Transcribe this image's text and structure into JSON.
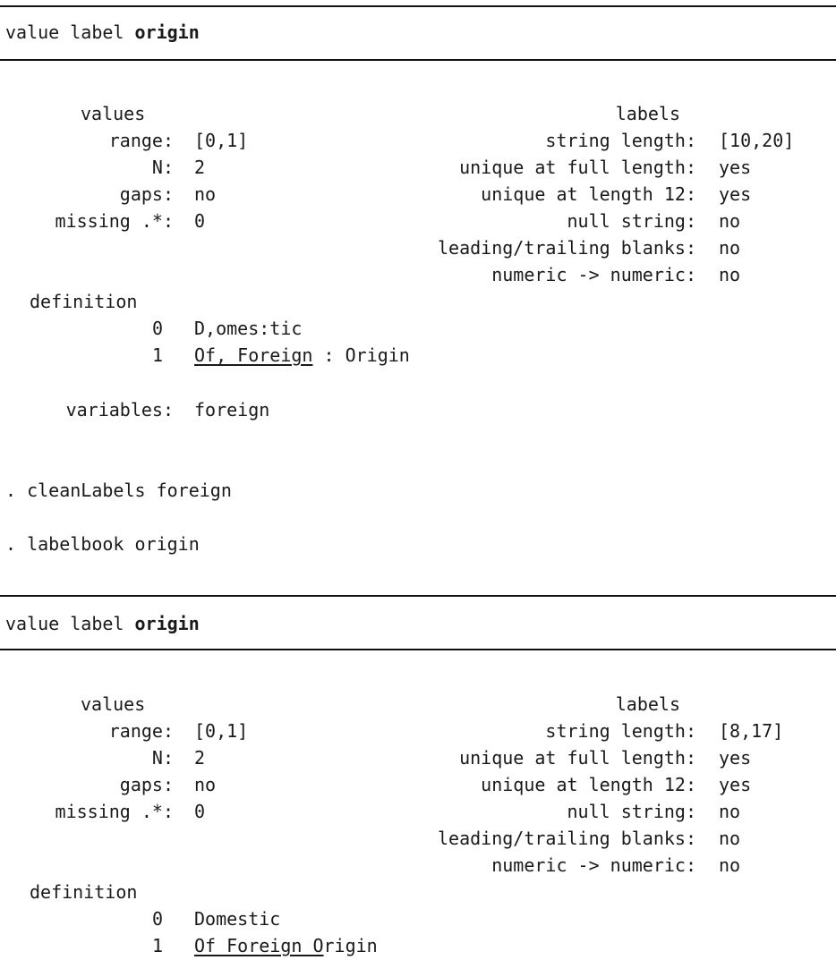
{
  "value_label_prefix": "value label",
  "label_name": "origin",
  "section_labels": {
    "values": "values",
    "labels": "labels",
    "range": "range:",
    "n": "N:",
    "gaps": "gaps:",
    "missing": "missing .*:",
    "string_length": "string length:",
    "unique_full": "unique at full length:",
    "unique_12": "unique at length 12:",
    "null_string": "null string:",
    "leading_trailing": "leading/trailing blanks:",
    "numeric_numeric": "numeric -> numeric:",
    "definition": "definition",
    "variables": "variables:"
  },
  "commands": [
    ". cleanLabels foreign",
    ". labelbook origin"
  ],
  "before": {
    "range": "[0,1]",
    "n": "2",
    "gaps": "no",
    "missing": "0",
    "string_length": "[10,20]",
    "unique_full": "yes",
    "unique_12": "yes",
    "null_string": "no",
    "leading_trailing": "no",
    "numeric_numeric": "no",
    "def0_value": "0",
    "def0_label": "D,omes:tic",
    "def1_value": "1",
    "def1_label_underlined": "Of, Foreign",
    "def1_label_rest": " : Origin",
    "variables": "foreign"
  },
  "after": {
    "range": "[0,1]",
    "n": "2",
    "gaps": "no",
    "missing": "0",
    "string_length": "[8,17]",
    "unique_full": "yes",
    "unique_12": "yes",
    "null_string": "no",
    "leading_trailing": "no",
    "numeric_numeric": "no",
    "def0_value": "0",
    "def0_label": "Domestic",
    "def1_value": "1",
    "def1_label_underlined": "Of Foreign O",
    "def1_label_rest": "rigin"
  }
}
